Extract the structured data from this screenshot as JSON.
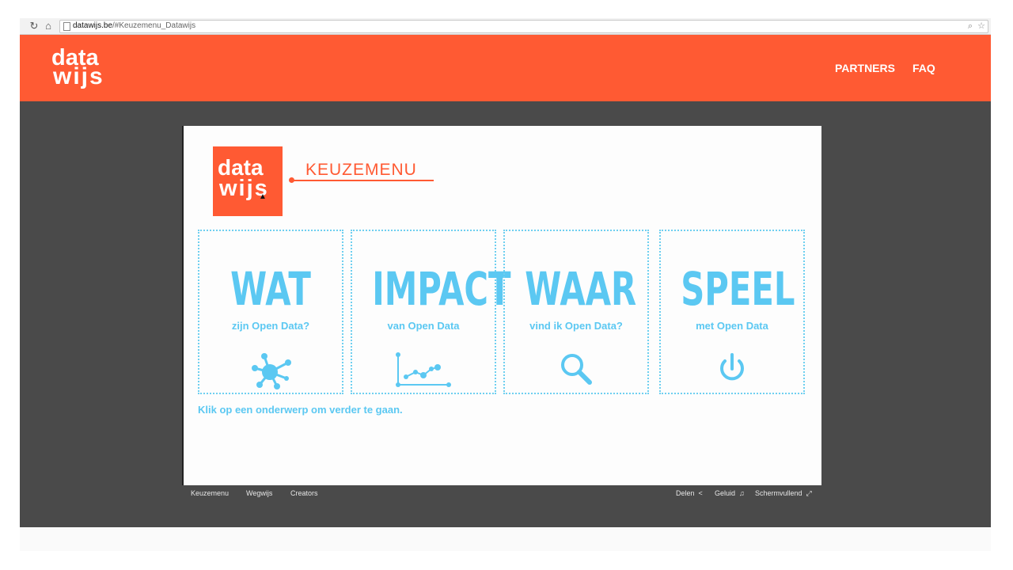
{
  "browser": {
    "url_domain": "datawijs.be",
    "url_path": "/#Keuzemenu_Datawijs"
  },
  "header": {
    "logo_line1": "data",
    "logo_line2": "wijs",
    "nav": [
      "PARTNERS",
      "FAQ"
    ]
  },
  "slide": {
    "logo_line1": "data",
    "logo_line2": "wijs",
    "title": "KEUZEMENU",
    "cards": [
      {
        "title": "WAT",
        "subtitle": "zijn Open Data?",
        "icon": "network-icon"
      },
      {
        "title": "IMPACT",
        "subtitle": "van Open Data",
        "icon": "line-chart-icon"
      },
      {
        "title": "WAAR",
        "subtitle": "vind ik Open Data?",
        "icon": "magnifier-icon"
      },
      {
        "title": "SPEEL",
        "subtitle": "met Open Data",
        "icon": "power-icon"
      }
    ],
    "hint": "Klik op een onderwerp om verder te gaan."
  },
  "player": {
    "left_links": [
      "Keuzemenu",
      "Wegwijs",
      "Creators"
    ],
    "share": "Delen",
    "sound": "Geluid",
    "fullscreen": "Schermvullend"
  },
  "colors": {
    "brand_orange": "#ff5a33",
    "accent_blue": "#5bc8f2",
    "stage_gray": "#4a4a4a"
  }
}
